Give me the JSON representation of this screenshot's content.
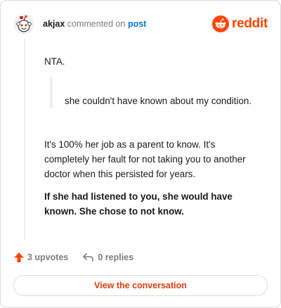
{
  "header": {
    "username": "akjax",
    "action_text": "commented on",
    "link_text": "post",
    "logo_text": "reddit",
    "avatar_icon": "snoo-avatar-icon",
    "logo_icon": "reddit-logo-icon"
  },
  "comment": {
    "line1": "NTA.",
    "quote": "she couldn't have known about my condition.",
    "paragraph2": "It's 100% her job as a parent to know. It's completely her fault for not taking you to another doctor when this persisted for years.",
    "paragraph3": "If she had listened to you, she would have known. She chose to not know."
  },
  "actions": {
    "upvotes_label": "3 upvotes",
    "replies_label": "0 replies",
    "upvote_icon": "upvote-arrow-icon",
    "reply_icon": "reply-arrow-icon"
  },
  "button": {
    "label": "View the conversation"
  },
  "colors": {
    "brand": "#ff4500",
    "link": "#0079d3",
    "muted": "#7c7c7c",
    "button_text": "#e03c0c"
  }
}
